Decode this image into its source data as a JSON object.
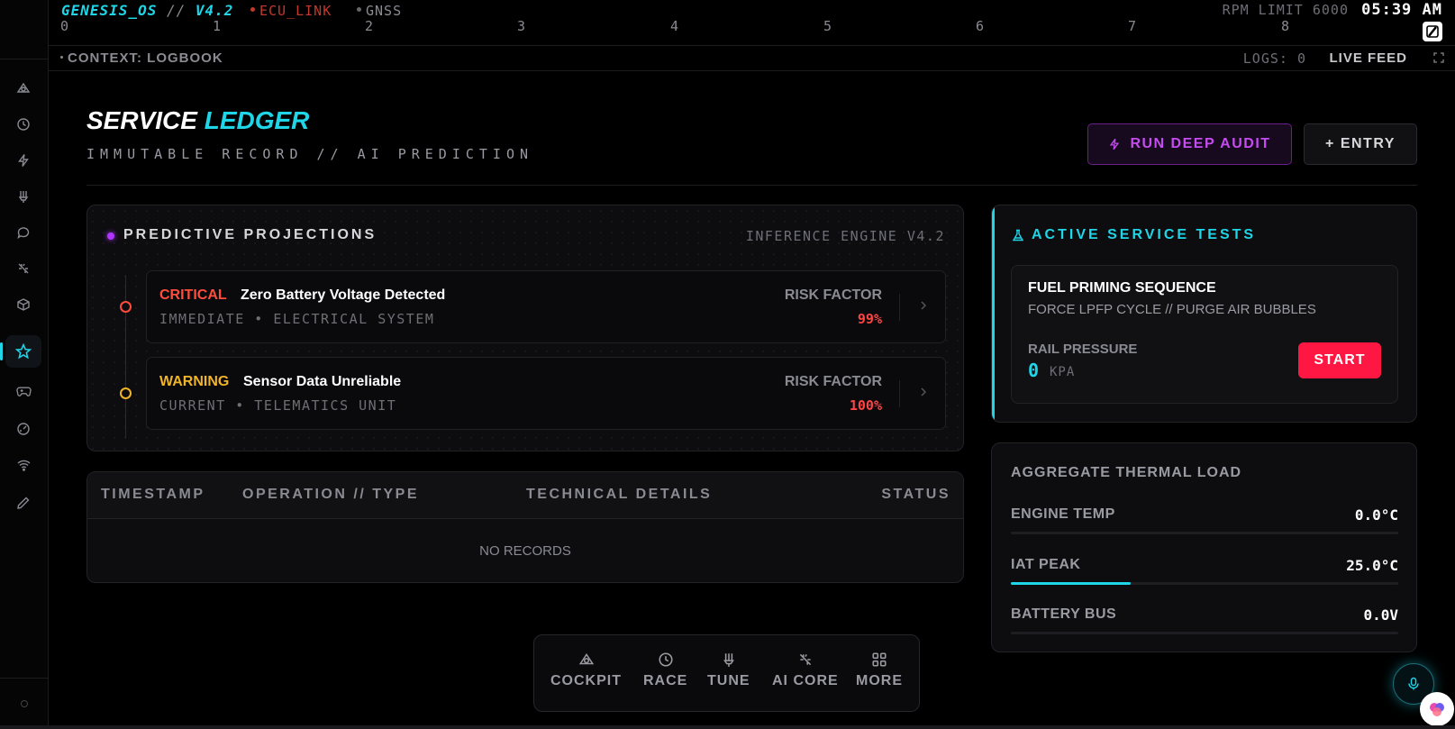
{
  "brand": {
    "os": "GENESIS_OS",
    "sep": " // ",
    "version": "V4.2"
  },
  "status": {
    "ecu": "ECU_LINK",
    "gnss": "GNSS",
    "ecu_color": "#c0392b"
  },
  "ruler": [
    "0",
    "1",
    "2",
    "3",
    "4",
    "5",
    "6",
    "7",
    "8"
  ],
  "rpm_limit": "RPM LIMIT 6000",
  "clock": "05:39 AM",
  "context": {
    "label": "CONTEXT: LOGBOOK",
    "logs": "LOGS: 0",
    "live": "LIVE FEED"
  },
  "header": {
    "title_a": "SERVICE",
    "title_b": "LEDGER",
    "subtitle": "IMMUTABLE RECORD // AI PREDICTION",
    "audit_label": "RUN DEEP AUDIT",
    "entry_label": "+ ENTRY"
  },
  "predictions": {
    "title": "PREDICTIVE PROJECTIONS",
    "engine": "INFERENCE ENGINE V4.2",
    "items": [
      {
        "level": "CRITICAL",
        "title": "Zero Battery Voltage Detected",
        "sub": "IMMEDIATE • ELECTRICAL SYSTEM",
        "risk_label": "RISK FACTOR",
        "risk": "99%",
        "color": "#ff4d3d"
      },
      {
        "level": "WARNING",
        "title": "Sensor Data Unreliable",
        "sub": "CURRENT • TELEMATICS UNIT",
        "risk_label": "RISK FACTOR",
        "risk": "100%",
        "color": "#f0b429"
      }
    ]
  },
  "table": {
    "headers": [
      "TIMESTAMP",
      "OPERATION // TYPE",
      "TECHNICAL DETAILS",
      "STATUS"
    ],
    "empty": "NO RECORDS"
  },
  "tests": {
    "title": "ACTIVE SERVICE TESTS",
    "card": {
      "title": "FUEL PRIMING SEQUENCE",
      "sub": "FORCE LPFP CYCLE // PURGE AIR BUBBLES",
      "metric_label": "RAIL PRESSURE",
      "metric_value": "0",
      "metric_unit": "KPA",
      "start_label": "START"
    }
  },
  "thermal": {
    "title": "AGGREGATE THERMAL LOAD",
    "rows": [
      {
        "label": "ENGINE TEMP",
        "value": "0.0°C",
        "fill": 0
      },
      {
        "label": "IAT PEAK",
        "value": "25.0°C",
        "fill": 0.31
      },
      {
        "label": "BATTERY BUS",
        "value": "0.0V",
        "fill": 0
      }
    ]
  },
  "dock": [
    {
      "label": "COCKPIT",
      "icon": "cockpit-icon"
    },
    {
      "label": "RACE",
      "icon": "clock-icon"
    },
    {
      "label": "TUNE",
      "icon": "tune-icon"
    },
    {
      "label": "AI CORE",
      "icon": "ai-core-icon"
    },
    {
      "label": "MORE",
      "icon": "grid-icon"
    }
  ],
  "colors": {
    "accent": "#1fd5e8",
    "purple": "#c64bf0",
    "danger": "#ff1744"
  }
}
